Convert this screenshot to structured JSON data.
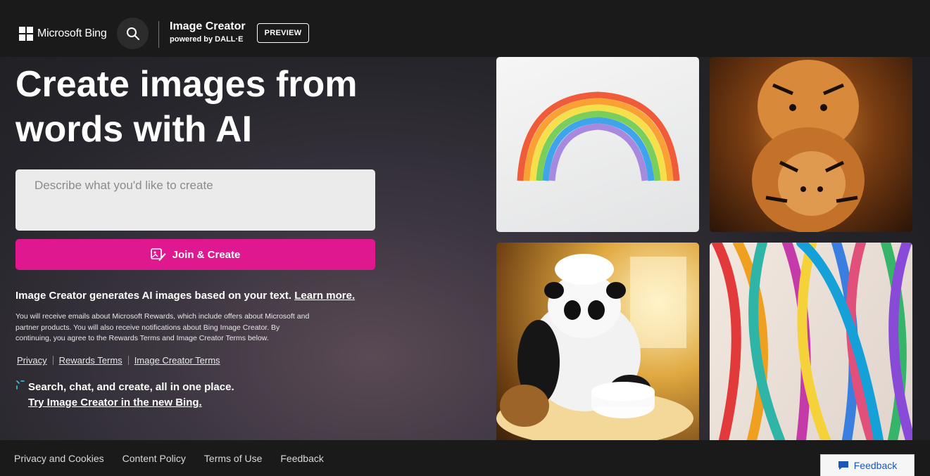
{
  "header": {
    "logo_text": "Microsoft Bing",
    "brand_title": "Image Creator",
    "brand_sub": "powered by DALL·E",
    "preview_label": "PREVIEW"
  },
  "hero": {
    "title_line1": "Create images from",
    "title_line2": "words with AI",
    "prompt_placeholder": "Describe what you'd like to create",
    "join_label": "Join & Create",
    "info_text": "Image Creator generates AI images based on your text. ",
    "learn_more": "Learn more.",
    "fine_print": "You will receive emails about Microsoft Rewards, which include offers about Microsoft and partner products. You will also receive notifications about Bing Image Creator. By continuing, you agree to the Rewards Terms and Image Creator Terms below.",
    "links": [
      "Privacy",
      "Rewards Terms",
      "Image Creator Terms"
    ],
    "promo_line1": "Search, chat, and create, all in one place.",
    "promo_link": "Try Image Creator in the new Bing."
  },
  "gallery": {
    "images": [
      {
        "icon": "rainbow-image"
      },
      {
        "icon": "tiger-dolls-image"
      },
      {
        "icon": "panda-chef-image"
      },
      {
        "icon": "ribbons-image"
      }
    ]
  },
  "footer": {
    "links": [
      "Privacy and Cookies",
      "Content Policy",
      "Terms of Use",
      "Feedback"
    ],
    "feedback_button": "Feedback"
  },
  "colors": {
    "accent": "#e0188f",
    "header_bg": "#1b1a1a",
    "link_blue": "#1a57b8"
  }
}
